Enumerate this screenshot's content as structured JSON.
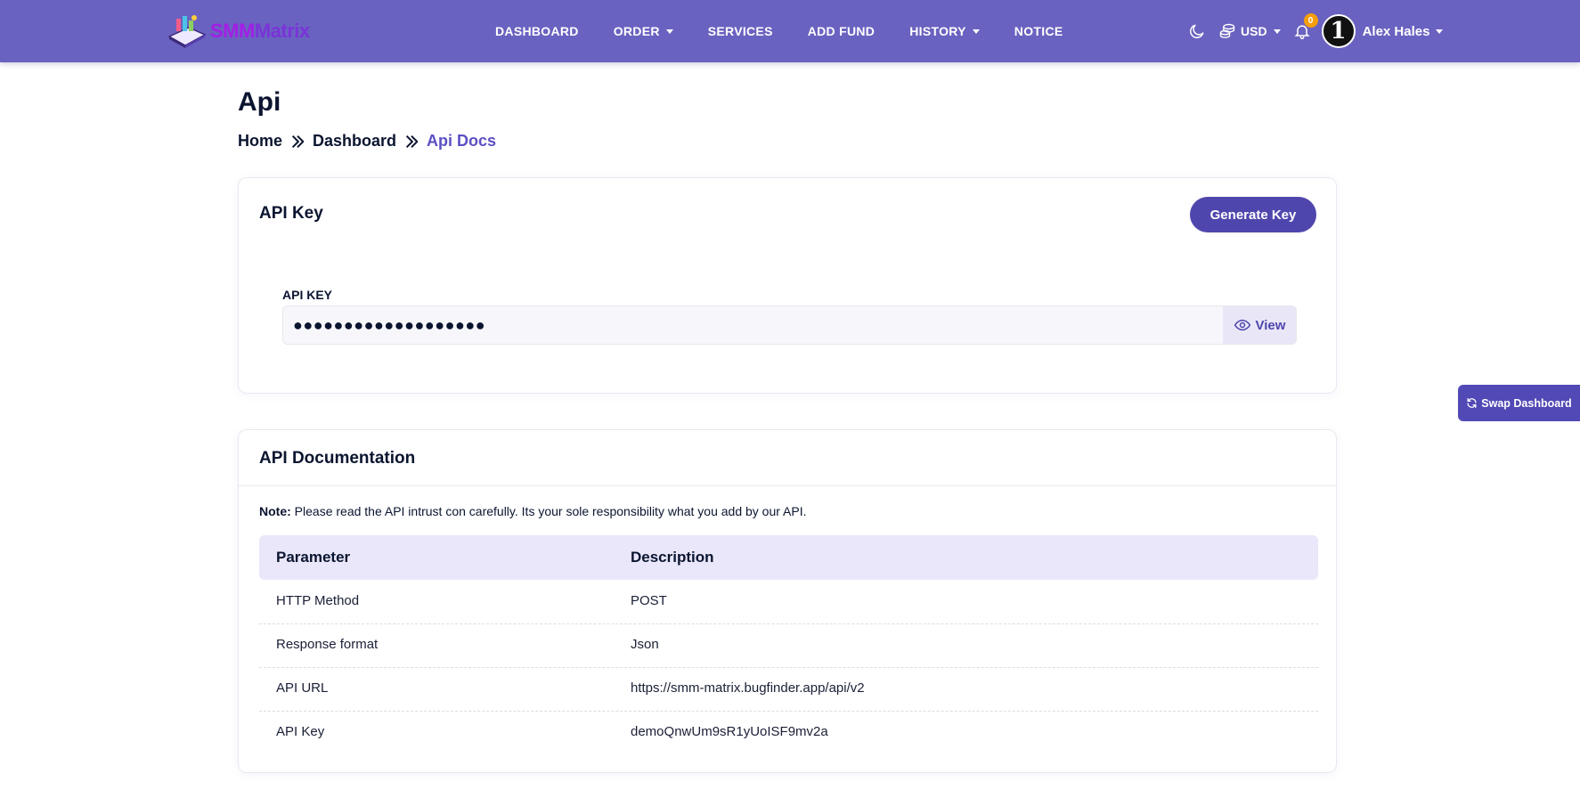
{
  "brand": {
    "logo_part1": "SMM",
    "logo_part2": "Matrix"
  },
  "nav": {
    "items": [
      {
        "label": "DASHBOARD",
        "has_caret": false
      },
      {
        "label": "ORDER",
        "has_caret": true
      },
      {
        "label": "SERVICES",
        "has_caret": false
      },
      {
        "label": "ADD FUND",
        "has_caret": false
      },
      {
        "label": "HISTORY",
        "has_caret": true
      },
      {
        "label": "NOTICE",
        "has_caret": false
      }
    ],
    "currency": "USD",
    "notification_count": "0",
    "avatar_text": "1",
    "user_name": "Alex Hales",
    "icons": [
      "moon-icon",
      "coins-icon",
      "bell-icon",
      "chevron-down-icon"
    ]
  },
  "page": {
    "title": "Api",
    "breadcrumb": [
      "Home",
      "Dashboard",
      "Api Docs"
    ]
  },
  "api_key_card": {
    "title": "API Key",
    "generate_button": "Generate Key",
    "field_label": "API KEY",
    "masked_value": "●●●●●●●●●●●●●●●●●●●",
    "view_button": "View"
  },
  "docs_card": {
    "title": "API Documentation",
    "note_label": "Note:",
    "note_text": " Please read the API intrust con carefully. Its your sole responsibility what you add by our API.",
    "columns": [
      "Parameter",
      "Description"
    ],
    "rows": [
      [
        "HTTP Method",
        "POST"
      ],
      [
        "Response format",
        "Json"
      ],
      [
        "API URL",
        "https://smm-matrix.bugfinder.app/api/v2"
      ],
      [
        "API Key",
        "demoQnwUm9sR1yUoISF9mv2a"
      ]
    ]
  },
  "swap_button": "Swap Dashboard",
  "colors": {
    "navbar": "#6a62c0",
    "primary": "#4f46ad",
    "accent_text": "#5b4fc4",
    "table_head": "#e9e7f9",
    "badge": "#f59e0b"
  }
}
